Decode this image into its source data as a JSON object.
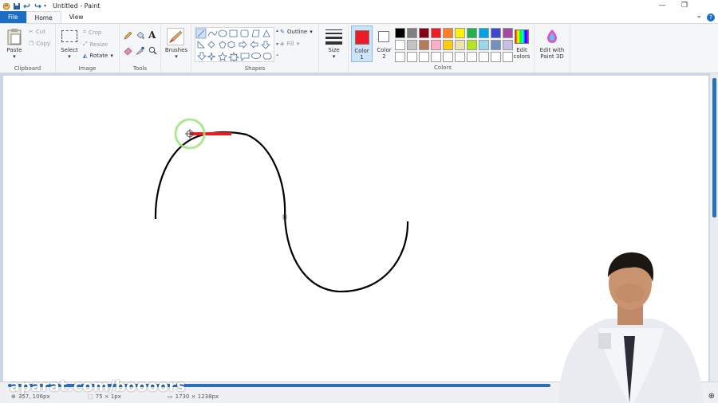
{
  "window": {
    "title": "Untitled - Paint"
  },
  "menu": {
    "file": "File",
    "home": "Home",
    "view": "View",
    "help": "?"
  },
  "clipboard": {
    "paste": "Paste",
    "cut": "Cut",
    "copy": "Copy",
    "label": "Clipboard"
  },
  "image": {
    "select": "Select",
    "crop": "Crop",
    "resize": "Resize",
    "rotate": "Rotate",
    "label": "Image"
  },
  "tools": {
    "label": "Tools"
  },
  "brushes": {
    "label": "Brushes"
  },
  "shapes": {
    "outline": "Outline",
    "fill": "Fill",
    "label": "Shapes"
  },
  "size": {
    "label": "Size"
  },
  "color1": {
    "label1": "Color",
    "label2": "1",
    "value": "#ed1c24"
  },
  "color2": {
    "label1": "Color",
    "label2": "2",
    "value": "#ffffff"
  },
  "colors": {
    "label": "Colors",
    "edit": "Edit colors",
    "palette": [
      "#000000",
      "#7f7f7f",
      "#880015",
      "#ed1c24",
      "#ff7f27",
      "#fff200",
      "#22b14c",
      "#00a2e8",
      "#3f48cc",
      "#a349a4",
      "#ffffff",
      "#c3c3c3",
      "#b97a57",
      "#ffaec9",
      "#ffc90e",
      "#efe4b0",
      "#b5e61d",
      "#99d9ea",
      "#7092be",
      "#c8bfe7",
      "#ffffff",
      "#ffffff",
      "#ffffff",
      "#ffffff",
      "#ffffff",
      "#ffffff",
      "#ffffff",
      "#ffffff",
      "#ffffff",
      "#ffffff"
    ]
  },
  "paint3d": {
    "line1": "Edit with",
    "line2": "Paint 3D"
  },
  "status": {
    "cursor": "357, 106px",
    "selection": "75 × 1px",
    "canvas_size": "1730 × 1238px"
  },
  "watermark": "aparat.com/boooors"
}
